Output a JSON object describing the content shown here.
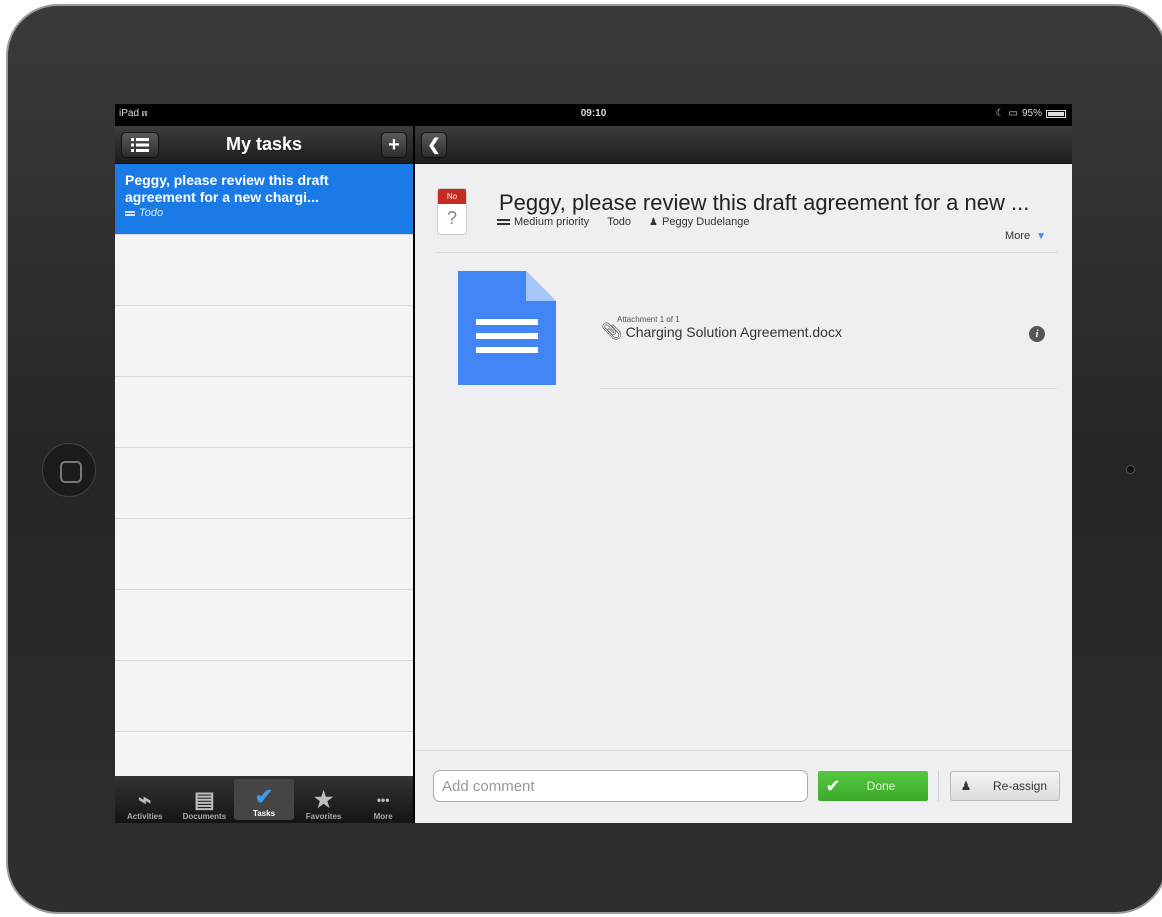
{
  "status_bar": {
    "device": "iPad",
    "wifi_icon": "wifi-icon",
    "time": "09:10",
    "battery": "95%"
  },
  "left_pane": {
    "title": "My tasks",
    "menu_icon": "list-menu-icon",
    "add_label": "+",
    "tasks": [
      {
        "title": "Peggy, please review this draft agreement for a new chargi...",
        "status": "Todo",
        "selected": true
      }
    ],
    "tab_bar": {
      "tabs": [
        {
          "label": "Activities",
          "icon": "activity-icon",
          "glyph": "⌁"
        },
        {
          "label": "Documents",
          "icon": "document-icon",
          "glyph": "▤"
        },
        {
          "label": "Tasks",
          "icon": "check-icon",
          "glyph": "✔",
          "active": true
        },
        {
          "label": "Favorites",
          "icon": "star-icon",
          "glyph": "★"
        },
        {
          "label": "More",
          "icon": "more-dots-icon",
          "glyph": "•••"
        }
      ]
    }
  },
  "task_detail": {
    "back_icon": "back-chevron-icon",
    "date_badge": {
      "label": "No Date",
      "value": "?"
    },
    "title": "Peggy, please review this draft agreement for a new ...",
    "priority": "Medium priority",
    "status": "Todo",
    "assignee": "Peggy Dudelange",
    "more_label": "More",
    "attachment": {
      "counter": "Attachment 1 of 1",
      "filename": "Charging Solution Agreement.docx"
    }
  },
  "footer": {
    "comment_placeholder": "Add comment",
    "done_label": "Done",
    "reassign_label": "Re-assign"
  },
  "colors": {
    "selection_blue": "#1a7ae6",
    "done_green": "#4dbd38",
    "date_red": "#c62b22",
    "doc_blue": "#4285f4"
  }
}
